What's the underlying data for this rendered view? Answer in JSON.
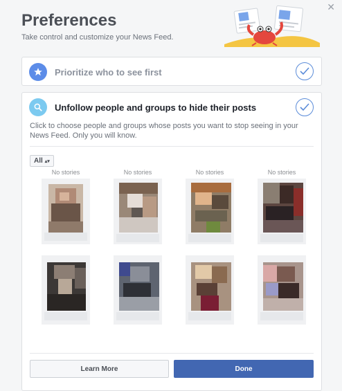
{
  "header": {
    "title": "Preferences",
    "subtitle": "Take control and customize your News Feed.",
    "close_icon": "close-icon"
  },
  "options": [
    {
      "label": "Prioritize who to see first",
      "icon": "star-icon",
      "checked": true
    },
    {
      "label": "Unfollow people and groups to hide their posts",
      "icon": "search-icon",
      "checked": true
    }
  ],
  "unfollow": {
    "description": "Click to choose people and groups whose posts you want to stop seeing in your News Feed. Only you will know.",
    "filter_value": "All",
    "column_labels": [
      "No stories",
      "No stories",
      "No stories",
      "No stories"
    ]
  },
  "buttons": {
    "learn_more": "Learn More",
    "done": "Done"
  },
  "colors": {
    "primary": "#4267b2",
    "accent_blue": "#5c8ce8",
    "accent_teal": "#7ccaf0",
    "check_border": "#5b8cd9"
  }
}
